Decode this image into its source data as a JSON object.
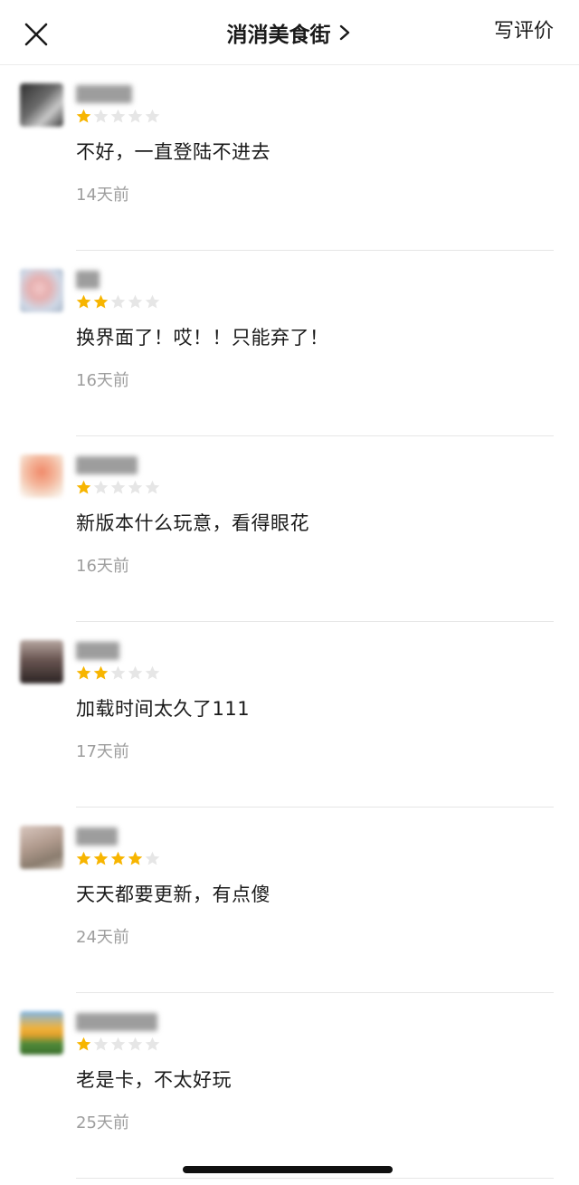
{
  "header": {
    "title": "消消美食街",
    "write_review": "写评价"
  },
  "reviews": [
    {
      "rating": 1,
      "text": "不好，一直登陆不进去",
      "time": "14天前"
    },
    {
      "rating": 2,
      "text": "换界面了！哎！！只能弃了！",
      "time": "16天前"
    },
    {
      "rating": 1,
      "text": "新版本什么玩意，看得眼花",
      "time": "16天前"
    },
    {
      "rating": 2,
      "text": "加载时间太久了111",
      "time": "17天前"
    },
    {
      "rating": 4,
      "text": "天天都要更新，有点傻",
      "time": "24天前"
    },
    {
      "rating": 1,
      "text": "老是卡，不太好玩",
      "time": "25天前"
    }
  ],
  "colors": {
    "star_filled": "#f7b500",
    "star_empty": "#e6e6e6",
    "time_text": "#9e9e9e"
  },
  "icons": {
    "close": "close-icon",
    "chevron": "chevron-right-icon",
    "star": "star-icon"
  }
}
